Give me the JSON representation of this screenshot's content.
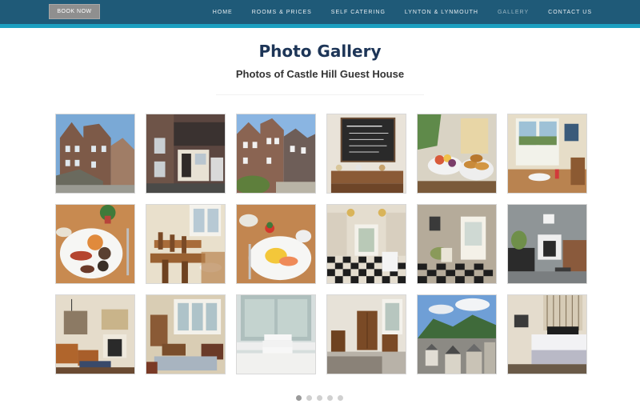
{
  "header": {
    "book_label": "BOOK NOW",
    "nav": [
      {
        "label": "HOME",
        "active": false
      },
      {
        "label": "ROOMS & PRICES",
        "active": false
      },
      {
        "label": "SELF CATERING",
        "active": false
      },
      {
        "label": "LYNTON & LYNMOUTH",
        "active": false
      },
      {
        "label": "GALLERY",
        "active": true
      },
      {
        "label": "CONTACT US",
        "active": false
      }
    ],
    "colors": {
      "bar": "#1f5a78",
      "stripe": "#1c9fc0",
      "button": "#8f8f8f"
    }
  },
  "main": {
    "title": "Photo Gallery",
    "subtitle": "Photos of Castle Hill Guest House"
  },
  "gallery": {
    "photos": [
      {
        "subject": "house-exterior-street"
      },
      {
        "subject": "house-exterior-doorway"
      },
      {
        "subject": "house-exterior-terrace"
      },
      {
        "subject": "breakfast-blackboard"
      },
      {
        "subject": "breakfast-pastries"
      },
      {
        "subject": "window-view-table"
      },
      {
        "subject": "full-english-breakfast"
      },
      {
        "subject": "dining-room"
      },
      {
        "subject": "salmon-eggs-breakfast"
      },
      {
        "subject": "hallway-checkered-floor"
      },
      {
        "subject": "hallway-doorway"
      },
      {
        "subject": "lounge-fireplace"
      },
      {
        "subject": "lounge-armchairs"
      },
      {
        "subject": "lounge-bay-window"
      },
      {
        "subject": "bathroom-towels"
      },
      {
        "subject": "bedroom-wardrobe"
      },
      {
        "subject": "town-rooftops-view"
      },
      {
        "subject": "bedroom-double-bed"
      }
    ]
  },
  "pagination": {
    "count": 5,
    "active": 1
  }
}
